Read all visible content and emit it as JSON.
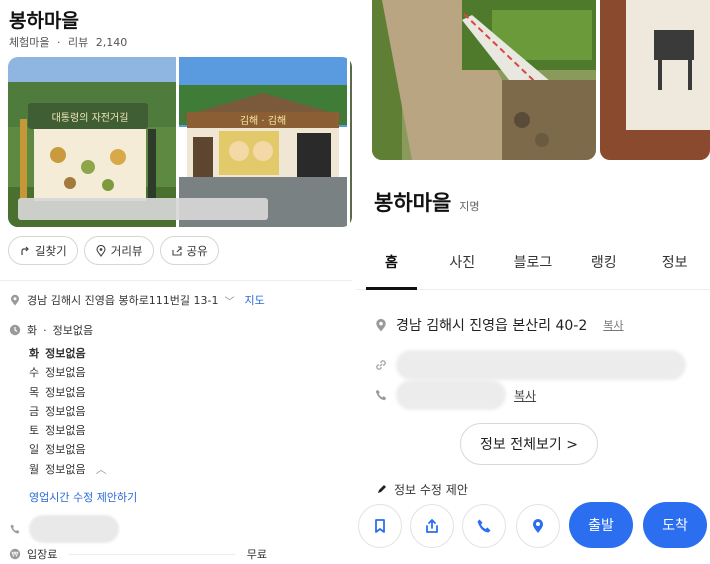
{
  "left": {
    "title": "봉하마을",
    "category": "체험마을",
    "separator": "·",
    "review_label": "리뷰",
    "review_count": "2,140",
    "photos": [
      {
        "sign_text": "대통령의 자전거길"
      },
      {
        "sign_text": "김해 · 김해"
      }
    ],
    "actions": [
      {
        "label": "길찾기",
        "icon": "directions-icon"
      },
      {
        "label": "거리뷰",
        "icon": "street-view-icon"
      },
      {
        "label": "공유",
        "icon": "share-icon"
      }
    ],
    "address": "경남 김해시 진영읍 봉하로111번길 13-1",
    "map_link": "지도",
    "hours_today_day": "화",
    "hours_today_sep": "·",
    "hours_today_status": "정보없음",
    "hours": [
      {
        "day": "화",
        "status": "정보없음"
      },
      {
        "day": "수",
        "status": "정보없음"
      },
      {
        "day": "목",
        "status": "정보없음"
      },
      {
        "day": "금",
        "status": "정보없음"
      },
      {
        "day": "토",
        "status": "정보없음"
      },
      {
        "day": "일",
        "status": "정보없음"
      },
      {
        "day": "월",
        "status": "정보없음"
      }
    ],
    "edit_hours": "영업시간 수정 제안하기",
    "fee_label": "입장료",
    "fee_value": "무료"
  },
  "right": {
    "title": "봉하마을",
    "category": "지명",
    "tabs": [
      "홈",
      "사진",
      "블로그",
      "랭킹",
      "정보"
    ],
    "active_tab": "홈",
    "address": "경남 김해시 진영읍 본산리 40-2",
    "copy_label": "복사",
    "phone_copy_label": "복사",
    "more_info": "정보 전체보기 >",
    "suggest_edit": "정보 수정 제안",
    "bottom": {
      "depart": "출발",
      "arrive": "도착"
    }
  },
  "colors": {
    "accent": "#2b6ef0",
    "link": "#2a6ad8"
  }
}
